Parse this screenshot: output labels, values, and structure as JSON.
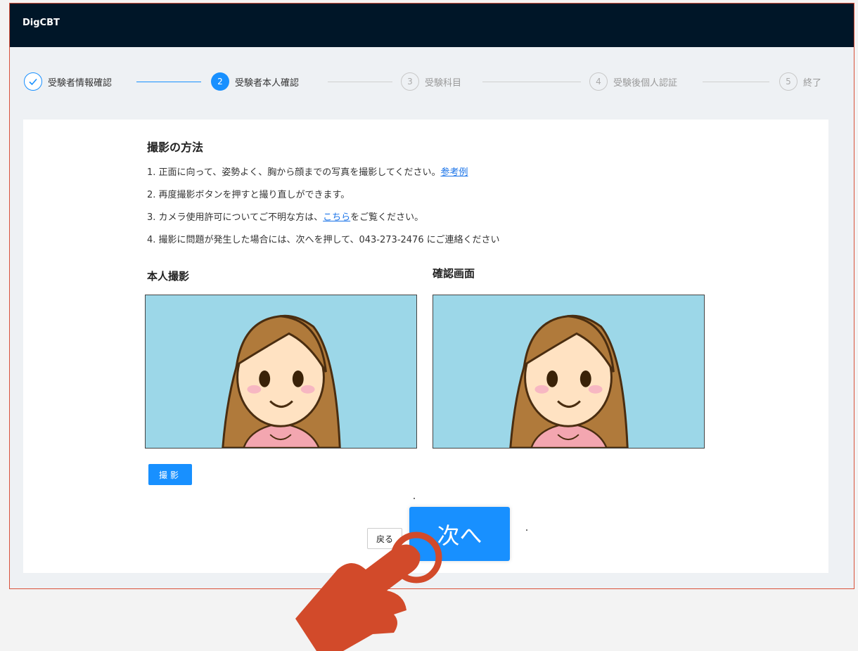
{
  "app": {
    "brand": "DigCBT"
  },
  "stepper": {
    "steps": [
      {
        "number": "✓",
        "label": "受験者情報確認",
        "state": "done"
      },
      {
        "number": "2",
        "label": "受験者本人確認",
        "state": "active"
      },
      {
        "number": "3",
        "label": "受験科目",
        "state": "pending"
      },
      {
        "number": "4",
        "label": "受験後個人認証",
        "state": "pending"
      },
      {
        "number": "5",
        "label": "終了",
        "state": "pending"
      }
    ]
  },
  "howto": {
    "title": "撮影の方法",
    "line1": {
      "text": "1. 正面に向って、姿勢よく、胸から顔までの写真を撮影してください。",
      "link": "参考例"
    },
    "line2": {
      "text": "2. 再度撮影ボタンを押すと撮り直しができます。"
    },
    "line3": {
      "before": "3. カメラ使用許可についてご不明な方は、",
      "link": "こちら",
      "after": "をご覧ください。"
    },
    "line4": {
      "text": "4. 撮影に問題が発生した場合には、次へを押して、043-273-2476 にご連絡ください"
    }
  },
  "capture": {
    "title": "本人撮影"
  },
  "preview": {
    "title": "確認画面"
  },
  "buttons": {
    "capture": "撮影",
    "back": "戻る",
    "next": "次へ"
  },
  "colors": {
    "accent": "#1890ff",
    "topbar": "#001628",
    "frame_border": "#d9513a",
    "photo_bg": "#9cd7e8",
    "hand": "#d24a2a"
  },
  "icons": {
    "step_done": "check-icon",
    "pointer": "pointing-hand-icon"
  }
}
